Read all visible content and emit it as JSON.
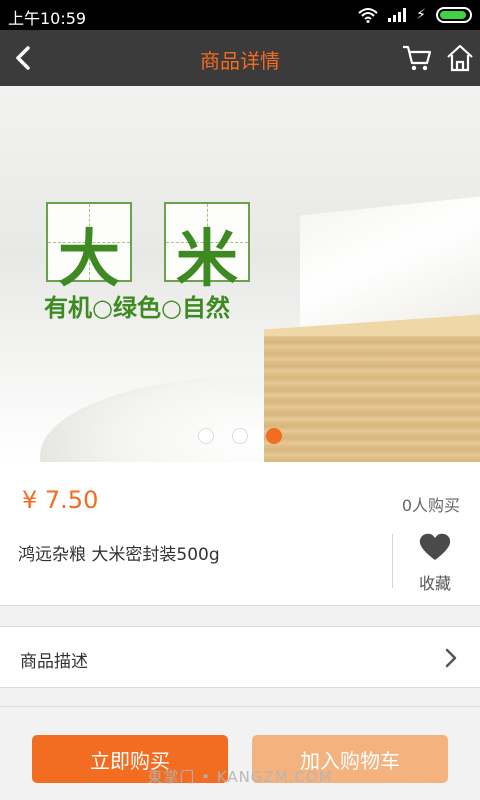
{
  "status_bar": {
    "time": "上午10:59"
  },
  "navbar": {
    "title": "商品详情"
  },
  "banner": {
    "char1": "大",
    "char2": "米",
    "slogan": "有机○绿色○自然",
    "dots_total": 3,
    "active_dot": 3
  },
  "product": {
    "price": "¥ 7.50",
    "sold": "0人购买",
    "name": "鸿远杂粮 大米密封装500g",
    "favorite_label": "收藏"
  },
  "description": {
    "label": "商品描述"
  },
  "actions": {
    "buy_now": "立即购买",
    "add_to_cart": "加入购物车"
  },
  "watermark": "東掌门 • KANGZM.COM",
  "colors": {
    "accent": "#f26c21",
    "accent_light": "#f4b37e",
    "navbar_bg": "#3b3b3b",
    "brand_green": "#3d8a22"
  }
}
